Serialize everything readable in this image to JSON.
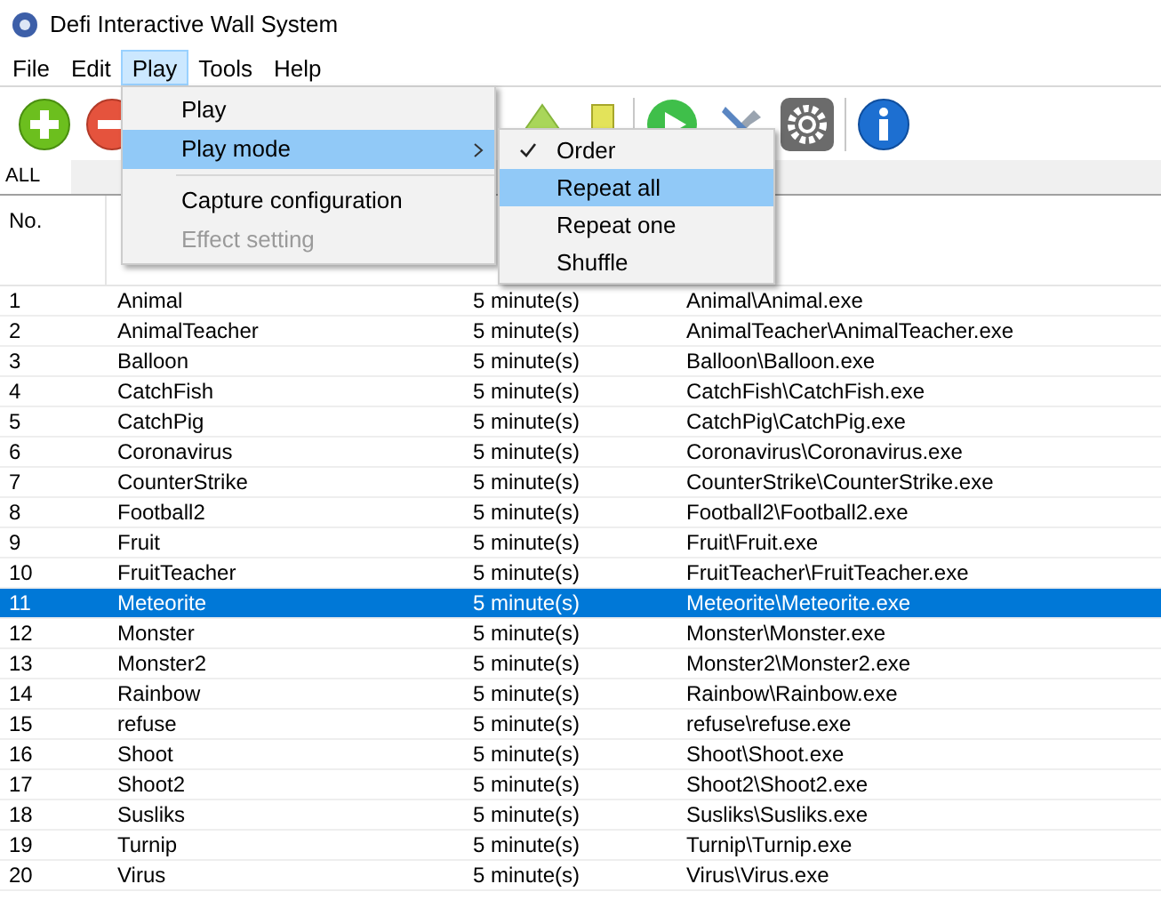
{
  "window": {
    "title": "Defi Interactive Wall System"
  },
  "menu_bar": [
    {
      "label": "File",
      "selected": false
    },
    {
      "label": "Edit",
      "selected": false
    },
    {
      "label": "Play",
      "selected": true
    },
    {
      "label": "Tools",
      "selected": false
    },
    {
      "label": "Help",
      "selected": false
    }
  ],
  "play_menu": [
    {
      "kind": "item",
      "label": "Play",
      "selected": false,
      "disabled": false,
      "has_submenu": false
    },
    {
      "kind": "item",
      "label": "Play mode",
      "selected": true,
      "disabled": false,
      "has_submenu": true
    },
    {
      "kind": "separator"
    },
    {
      "kind": "item",
      "label": "Capture configuration",
      "selected": false,
      "disabled": false,
      "has_submenu": false
    },
    {
      "kind": "item",
      "label": "Effect setting",
      "selected": false,
      "disabled": true,
      "has_submenu": false
    }
  ],
  "play_mode_menu": [
    {
      "label": "Order",
      "checked": true,
      "selected": false
    },
    {
      "label": "Repeat all",
      "checked": false,
      "selected": true
    },
    {
      "label": "Repeat one",
      "checked": false,
      "selected": false
    },
    {
      "label": "Shuffle",
      "checked": false,
      "selected": false
    }
  ],
  "tabs": [
    {
      "label": "ALL",
      "selected": true
    }
  ],
  "table": {
    "columns": [
      "No."
    ],
    "rows": [
      {
        "no": "1",
        "name": "Animal",
        "duration": "5 minute(s)",
        "path": "Animal\\Animal.exe",
        "selected": false
      },
      {
        "no": "2",
        "name": "AnimalTeacher",
        "duration": "5 minute(s)",
        "path": "AnimalTeacher\\AnimalTeacher.exe",
        "selected": false
      },
      {
        "no": "3",
        "name": "Balloon",
        "duration": "5 minute(s)",
        "path": "Balloon\\Balloon.exe",
        "selected": false
      },
      {
        "no": "4",
        "name": "CatchFish",
        "duration": "5 minute(s)",
        "path": "CatchFish\\CatchFish.exe",
        "selected": false
      },
      {
        "no": "5",
        "name": "CatchPig",
        "duration": "5 minute(s)",
        "path": "CatchPig\\CatchPig.exe",
        "selected": false
      },
      {
        "no": "6",
        "name": "Coronavirus",
        "duration": "5 minute(s)",
        "path": "Coronavirus\\Coronavirus.exe",
        "selected": false
      },
      {
        "no": "7",
        "name": "CounterStrike",
        "duration": "5 minute(s)",
        "path": "CounterStrike\\CounterStrike.exe",
        "selected": false
      },
      {
        "no": "8",
        "name": "Football2",
        "duration": "5 minute(s)",
        "path": "Football2\\Football2.exe",
        "selected": false
      },
      {
        "no": "9",
        "name": "Fruit",
        "duration": "5 minute(s)",
        "path": "Fruit\\Fruit.exe",
        "selected": false
      },
      {
        "no": "10",
        "name": "FruitTeacher",
        "duration": "5 minute(s)",
        "path": "FruitTeacher\\FruitTeacher.exe",
        "selected": false
      },
      {
        "no": "11",
        "name": "Meteorite",
        "duration": "5 minute(s)",
        "path": "Meteorite\\Meteorite.exe",
        "selected": true
      },
      {
        "no": "12",
        "name": "Monster",
        "duration": "5 minute(s)",
        "path": "Monster\\Monster.exe",
        "selected": false
      },
      {
        "no": "13",
        "name": "Monster2",
        "duration": "5 minute(s)",
        "path": "Monster2\\Monster2.exe",
        "selected": false
      },
      {
        "no": "14",
        "name": "Rainbow",
        "duration": "5 minute(s)",
        "path": "Rainbow\\Rainbow.exe",
        "selected": false
      },
      {
        "no": "15",
        "name": "refuse",
        "duration": "5 minute(s)",
        "path": "refuse\\refuse.exe",
        "selected": false
      },
      {
        "no": "16",
        "name": "Shoot",
        "duration": "5 minute(s)",
        "path": "Shoot\\Shoot.exe",
        "selected": false
      },
      {
        "no": "17",
        "name": "Shoot2",
        "duration": "5 minute(s)",
        "path": "Shoot2\\Shoot2.exe",
        "selected": false
      },
      {
        "no": "18",
        "name": "Susliks",
        "duration": "5 minute(s)",
        "path": "Susliks\\Susliks.exe",
        "selected": false
      },
      {
        "no": "19",
        "name": "Turnip",
        "duration": "5 minute(s)",
        "path": "Turnip\\Turnip.exe",
        "selected": false
      },
      {
        "no": "20",
        "name": "Virus",
        "duration": "5 minute(s)",
        "path": "Virus\\Virus.exe",
        "selected": false
      }
    ]
  }
}
